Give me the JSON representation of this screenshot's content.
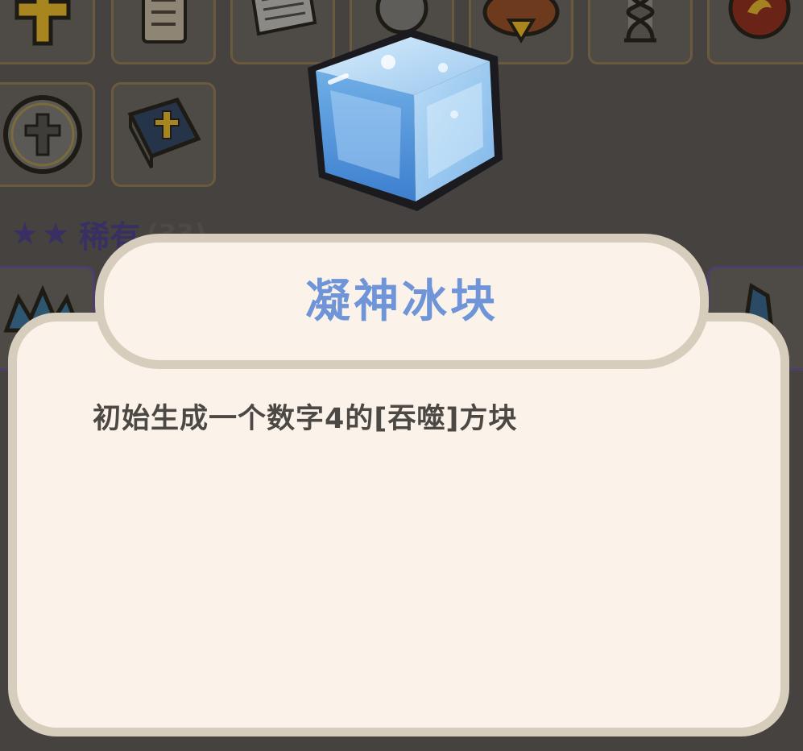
{
  "collection": {
    "rare_section": {
      "stars": "★★",
      "label": "稀有",
      "count": "(33)"
    }
  },
  "dialog": {
    "title": "凝神冰块",
    "description": "初始生成一个数字4的[吞噬]方块"
  },
  "item": {
    "icon": "ice-cube-icon"
  },
  "colors": {
    "title": "#6f94d8",
    "dialog_bg": "#fbf3ea",
    "dialog_border": "#d7cdbc",
    "overlay_bg": "#45423f",
    "rare_accent": "#3a2f63"
  }
}
